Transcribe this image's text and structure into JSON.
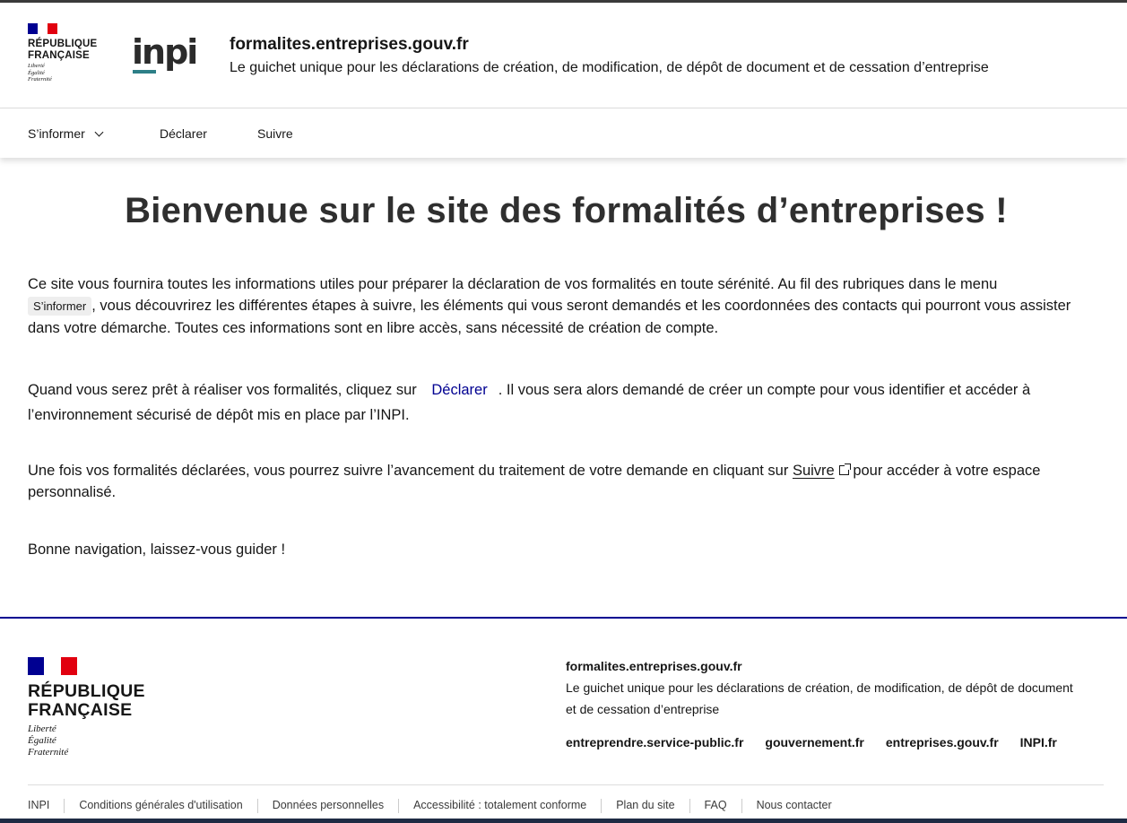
{
  "header": {
    "rf_name_line1": "RÉPUBLIQUE",
    "rf_name_line2": "FRANÇAISE",
    "rf_motto_1": "Liberté",
    "rf_motto_2": "Égalité",
    "rf_motto_3": "Fraternité",
    "inpi_logo": "inpi",
    "service_title": "formalites.entreprises.gouv.fr",
    "service_tagline": "Le guichet unique pour les déclarations de création, de modification, de dépôt de document et de cessation d’entreprise"
  },
  "nav": {
    "items": [
      {
        "label": "S’informer",
        "icon": "chevron-down-icon"
      },
      {
        "label": "Déclarer"
      },
      {
        "label": "Suivre"
      }
    ]
  },
  "main": {
    "title": "Bienvenue sur le site des formalités d’entreprises !",
    "p1_start": "Ce site vous fournira toutes les informations utiles pour préparer la déclaration de vos formalités en toute sérénité. Au fil des rubriques dans le menu",
    "p1_tag": "S’informer",
    "p1_end": ", vous découvrirez les différentes étapes à suivre, les éléments qui vous seront demandés et les coordonnées des contacts qui pourront vous assister dans votre démarche. Toutes ces informations sont en libre accès, sans nécessité de création de compte.",
    "p2_start": "Quand vous serez prêt à réaliser vos formalités, cliquez sur",
    "p2_link": "Déclarer",
    "p2_end": ". Il vous sera alors demandé de créer un compte pour vous identifier et accéder à l’environnement sécurisé de dépôt mis en place par l’INPI.",
    "p3_start": "Une fois vos formalités déclarées, vous pourrez suivre l’avancement du traitement de votre demande en cliquant sur",
    "p3_link": "Suivre",
    "p3_end": "pour accéder à votre espace personnalisé.",
    "p4": "Bonne navigation, laissez-vous guider !"
  },
  "footer": {
    "rf_name_line1": "RÉPUBLIQUE",
    "rf_name_line2": "FRANÇAISE",
    "rf_motto_1": "Liberté",
    "rf_motto_2": "Égalité",
    "rf_motto_3": "Fraternité",
    "title": "formalites.entreprises.gouv.fr",
    "description": "Le guichet unique pour les déclarations de création, de modification, de dépôt de document et de cessation d’entreprise",
    "links": [
      "entreprendre.service-public.fr",
      "gouvernement.fr",
      "entreprises.gouv.fr",
      "INPI.fr"
    ],
    "bottom_links": [
      "INPI",
      "Conditions générales d'utilisation",
      "Données personnelles",
      "Accessibilité : totalement conforme",
      "Plan du site",
      "FAQ",
      "Nous contacter"
    ]
  },
  "colors": {
    "accent_blue": "#000091",
    "flag_red": "#e1000f",
    "inpi_teal": "#2d7f87"
  }
}
